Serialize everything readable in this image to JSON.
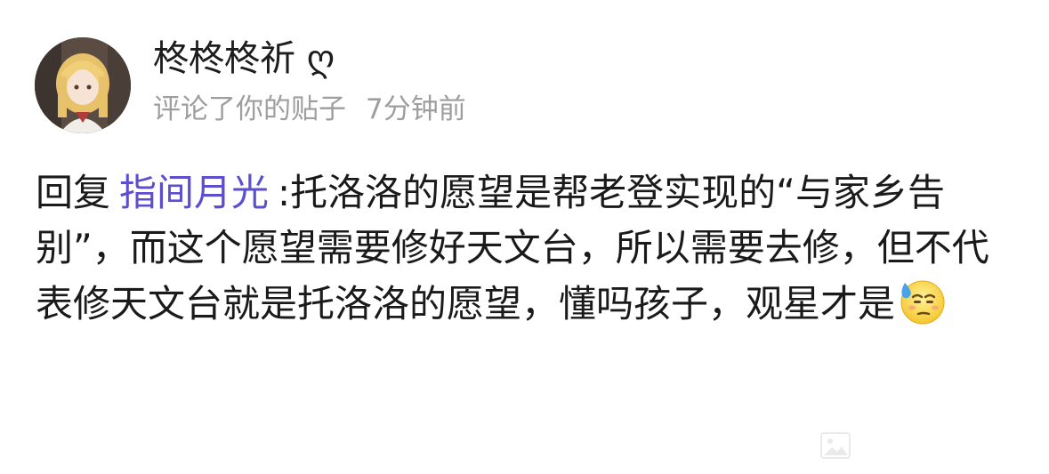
{
  "post": {
    "username": "柊柊柊祈 ღ",
    "action": "评论了你的贴子",
    "time": "7分钟前",
    "reply_prefix": "回复",
    "mention": "指间月光",
    "comment_text": ":托洛洛的愿望是帮老登实现的“与家乡告别”，而这个愿望需要修好天文台，所以需要去修，但不代表修天文台就是托洛洛的愿望，懂吗孩子，观星才是",
    "emoji": "sweat-smile-emoji"
  },
  "colors": {
    "mention": "#5b4fcf",
    "meta_text": "#9e9e9e",
    "main_text": "#1a1a1a"
  },
  "icons": {
    "avatar": "anime-girl-avatar",
    "watermark": "image-watermark-icon"
  }
}
